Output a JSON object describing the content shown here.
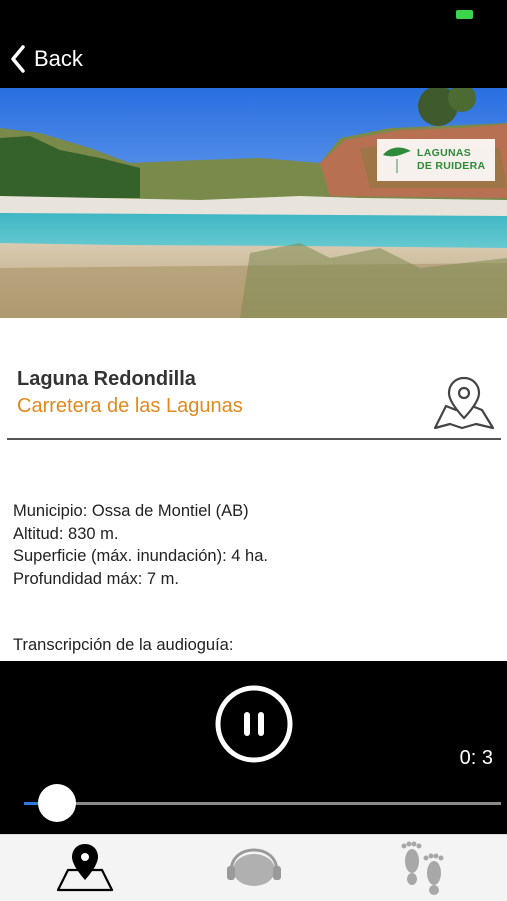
{
  "nav": {
    "back_label": "Back"
  },
  "hero": {
    "logo_line1": "LAGUNAS",
    "logo_line2": "DE RUIDERA"
  },
  "place": {
    "name": "Laguna Redondilla",
    "route": "Carretera de las Lagunas"
  },
  "info": [
    "Municipio: Ossa de Montiel (AB)",
    "Altitud: 830 m.",
    "Superficie (máx. inundación): 4 ha.",
    "Profundidad máx: 7 m."
  ],
  "transcript_label": "Transcripción de la audioguía:",
  "player": {
    "time": "0: 3",
    "state": "playing",
    "progress": 0.07
  },
  "tabs": [
    {
      "name": "map-tab",
      "icon": "map-pin-icon",
      "active": true
    },
    {
      "name": "audio-tab",
      "icon": "headphones-icon",
      "active": false
    },
    {
      "name": "walk-tab",
      "icon": "footprints-icon",
      "active": false
    }
  ],
  "colors": {
    "accent": "#e08a1e",
    "logo_green": "#2f8a3a",
    "progress": "#2a7be0"
  }
}
